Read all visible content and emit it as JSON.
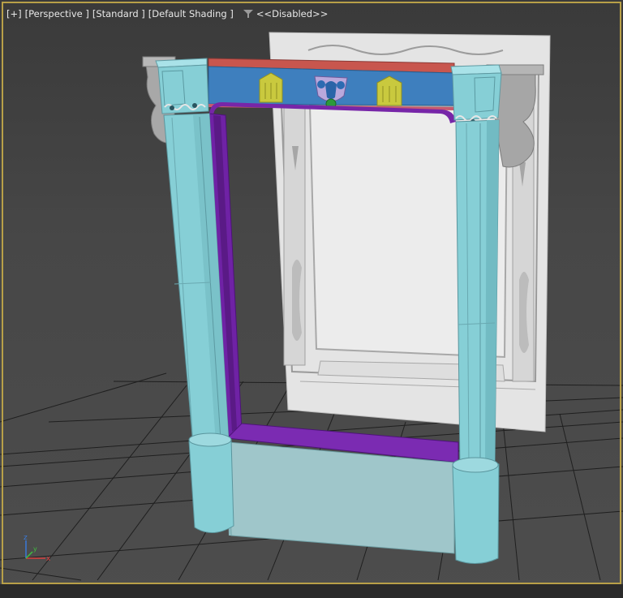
{
  "viewport": {
    "labels": [
      "[+]",
      "[Perspective ]",
      "[Standard ]",
      "[Default Shading ]"
    ],
    "filter_icon": "funnel-icon",
    "filter_status": "<<Disabled>>"
  },
  "axis_gizmo": {
    "z_label": "z",
    "x_label": "x",
    "y_label": "y"
  },
  "colors": {
    "frame_border": "#b8a048",
    "column": "#86cfd6",
    "lintel_blue": "#3d7fbf",
    "lintel_top_red": "#c9574f",
    "frame_purple": "#6c22a4",
    "shields_yellow": "#c9c840",
    "backdrop_panel": "#e3e3e3",
    "grid_line": "#1e1e1e"
  }
}
